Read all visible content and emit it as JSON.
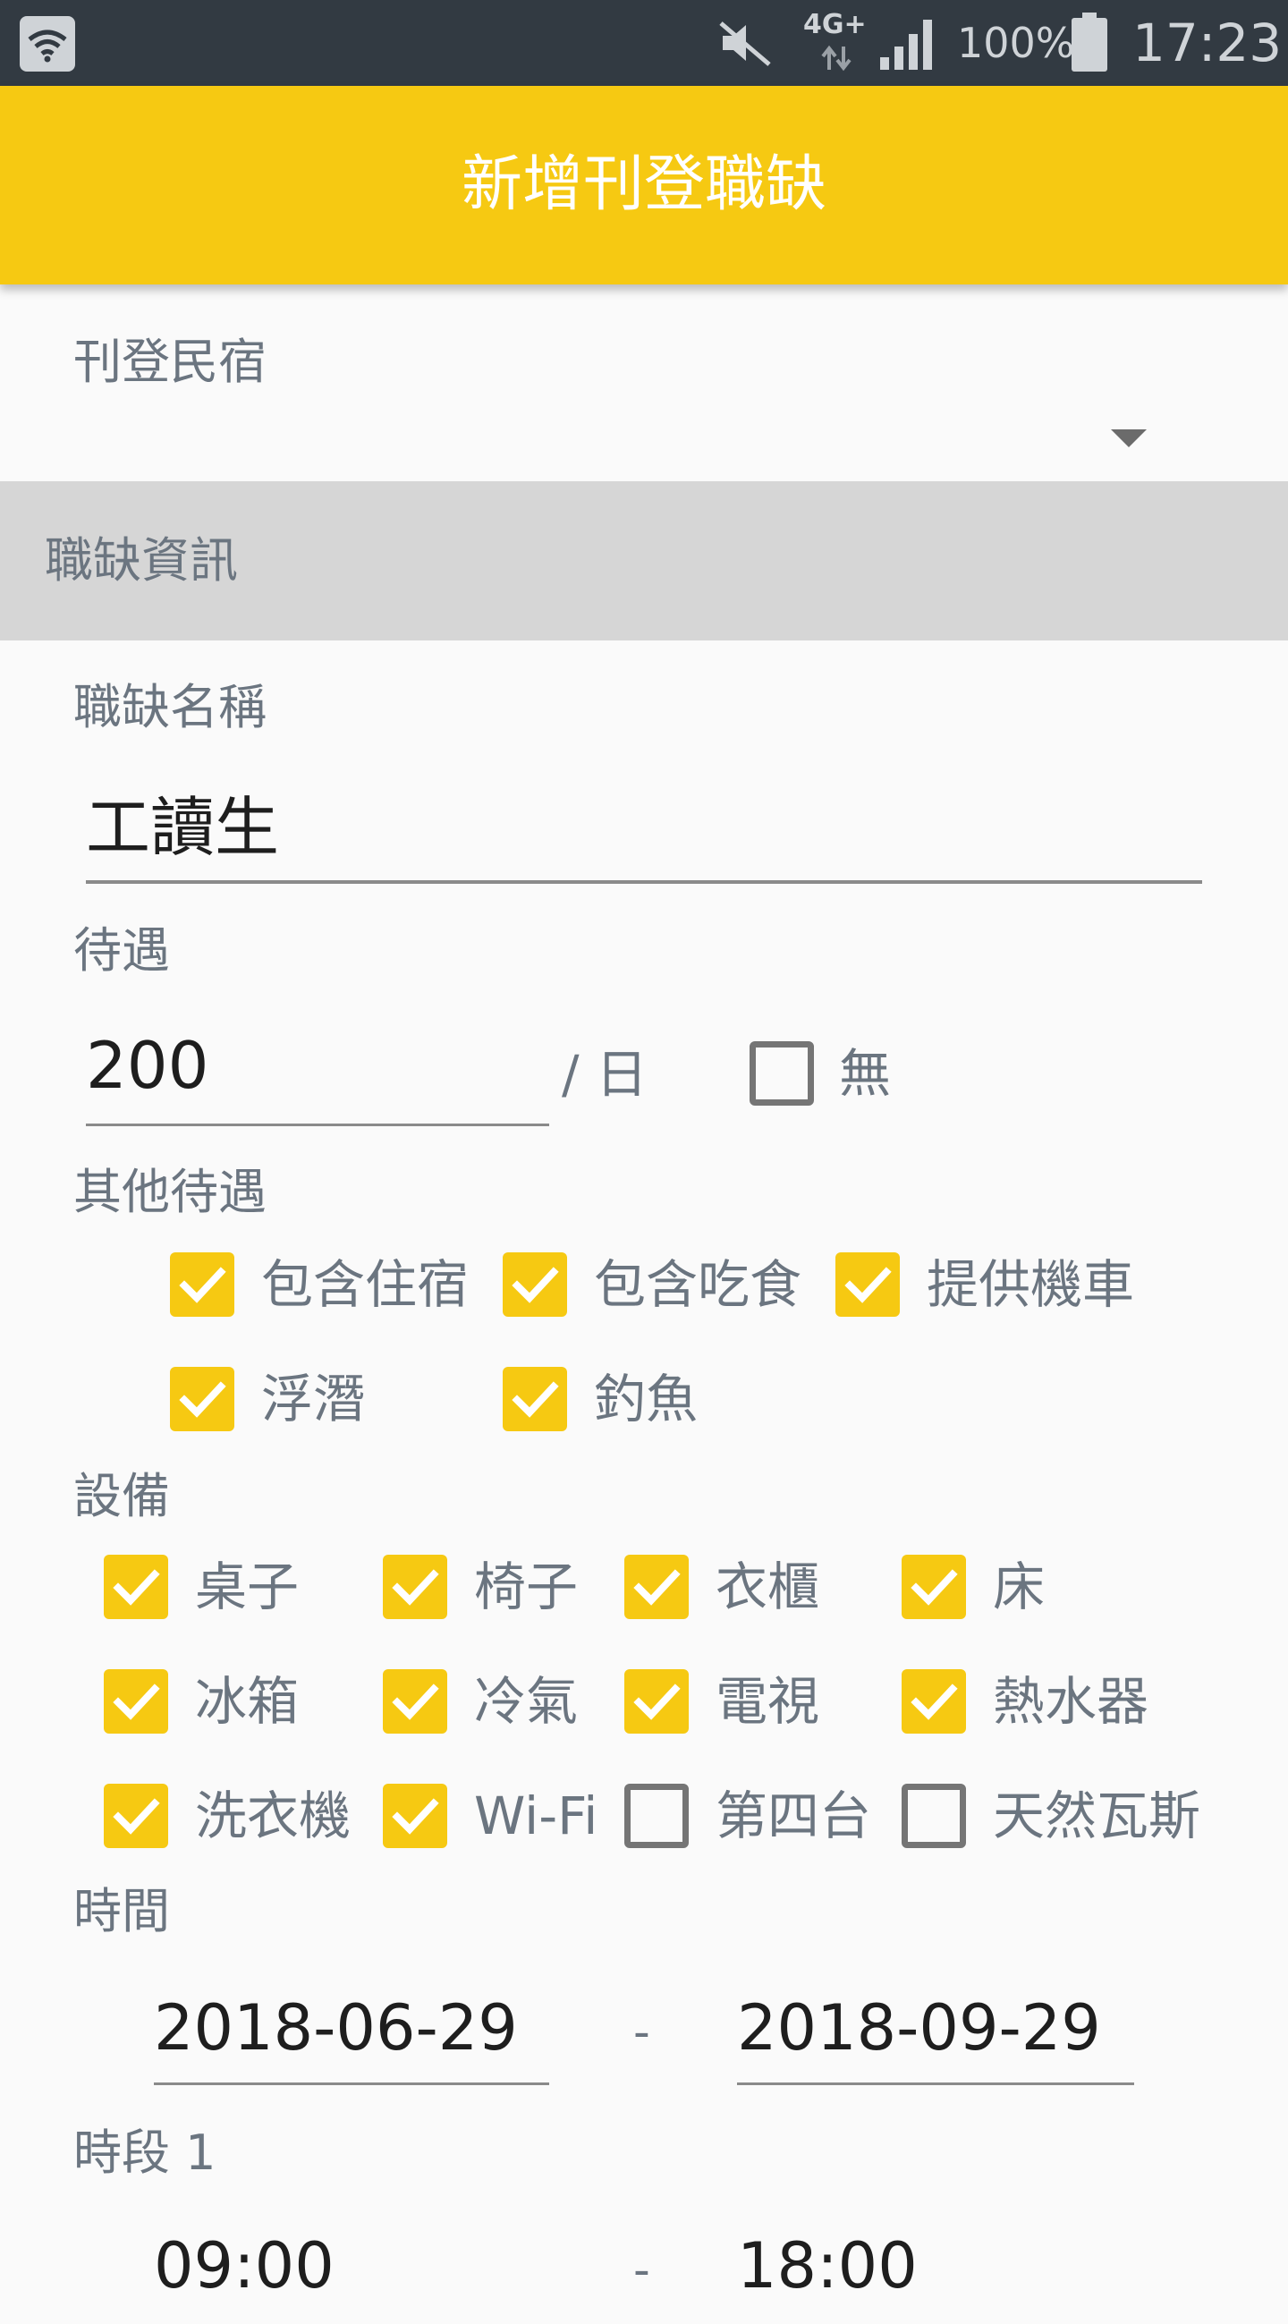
{
  "status_bar": {
    "network": "4G+",
    "battery": "100%",
    "time": "17:23"
  },
  "app_bar": {
    "title": "新增刊登職缺"
  },
  "homestay": {
    "label": "刊登民宿",
    "value": ""
  },
  "section": {
    "title": "職缺資訊"
  },
  "job_name": {
    "label": "職缺名稱",
    "value": "工讀生"
  },
  "salary": {
    "label": "待遇",
    "value": "200",
    "unit": "/ 日",
    "none_label": "無",
    "none_checked": false
  },
  "benefits": {
    "label": "其他待遇",
    "items": [
      {
        "label": "包含住宿",
        "checked": true
      },
      {
        "label": "包含吃食",
        "checked": true
      },
      {
        "label": "提供機車",
        "checked": true
      },
      {
        "label": "浮潛",
        "checked": true
      },
      {
        "label": "釣魚",
        "checked": true
      }
    ]
  },
  "equipment": {
    "label": "設備",
    "items": [
      {
        "label": "桌子",
        "checked": true
      },
      {
        "label": "椅子",
        "checked": true
      },
      {
        "label": "衣櫃",
        "checked": true
      },
      {
        "label": "床",
        "checked": true
      },
      {
        "label": "冰箱",
        "checked": true
      },
      {
        "label": "冷氣",
        "checked": true
      },
      {
        "label": "電視",
        "checked": true
      },
      {
        "label": "熱水器",
        "checked": true
      },
      {
        "label": "洗衣機",
        "checked": true
      },
      {
        "label": "Wi-Fi",
        "checked": true
      },
      {
        "label": "第四台",
        "checked": false
      },
      {
        "label": "天然瓦斯",
        "checked": false
      }
    ]
  },
  "period": {
    "label": "時間",
    "start": "2018-06-29",
    "separator": "-",
    "end": "2018-09-29"
  },
  "slot1": {
    "label": "時段 1",
    "start": "09:00",
    "separator": "-",
    "end": "18:00"
  },
  "colors": {
    "accent": "#f6c912",
    "status_bar": "#323a42",
    "section_bg": "#d6d6d6"
  }
}
